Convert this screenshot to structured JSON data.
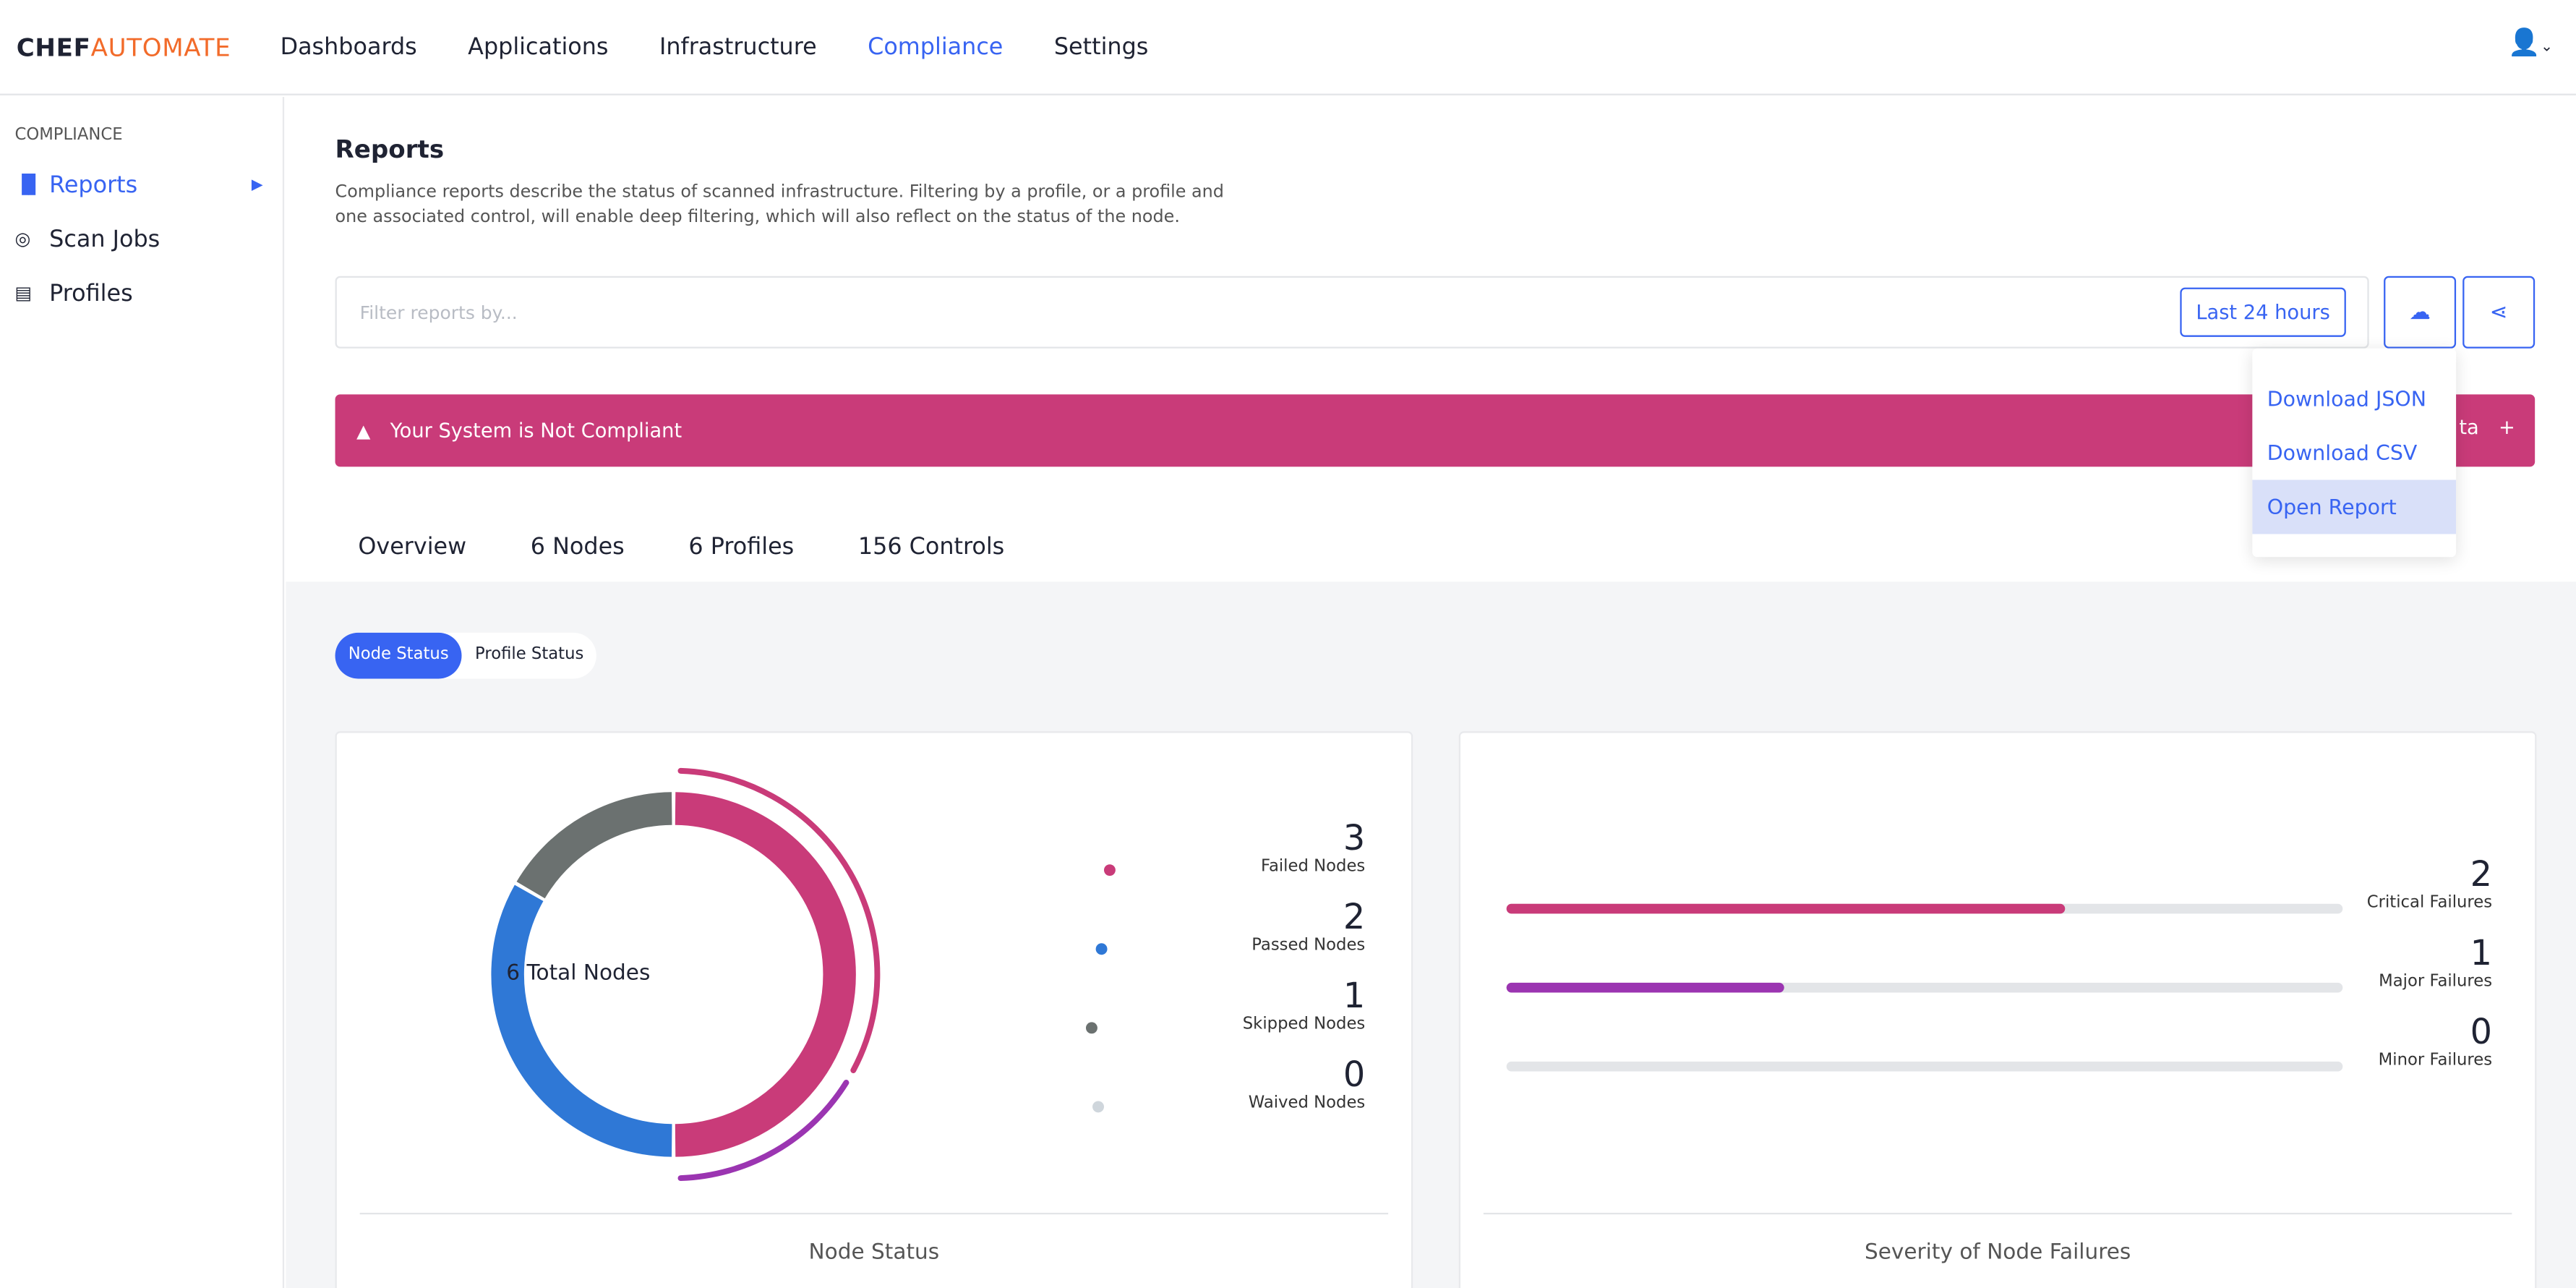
{
  "brand": {
    "part1": "CHEF",
    "part2": "AUTOMATE"
  },
  "nav": [
    "Dashboards",
    "Applications",
    "Infrastructure",
    "Compliance",
    "Settings"
  ],
  "nav_active": "Compliance",
  "sidebar": {
    "heading": "COMPLIANCE",
    "items": [
      {
        "label": "Reports",
        "icon": "bar-chart-icon"
      },
      {
        "label": "Scan Jobs",
        "icon": "radar-icon"
      },
      {
        "label": "Profiles",
        "icon": "book-icon"
      }
    ]
  },
  "page": {
    "title": "Reports",
    "description": "Compliance reports describe the status of scanned infrastructure. Filtering by a profile, or a profile and one associated control, will enable deep filtering, which will also reflect on the status of the node."
  },
  "filter": {
    "placeholder": "Filter reports by...",
    "time_range": "Last 24 hours"
  },
  "download_menu": [
    "Download JSON",
    "Download CSV",
    "Open Report"
  ],
  "alert": {
    "text": "Your System is Not Compliant",
    "partial_right": "ta",
    "plus": "+"
  },
  "tabs": [
    "Overview",
    "6 Nodes",
    "6 Profiles",
    "156 Controls"
  ],
  "toggle": [
    "Node Status",
    "Profile Status"
  ],
  "node_status": {
    "center": "6 Total Nodes",
    "footer": "Node Status",
    "items": [
      {
        "count": "3",
        "label": "Failed Nodes",
        "color": "#c93b79"
      },
      {
        "count": "2",
        "label": "Passed Nodes",
        "color": "#2f78d6"
      },
      {
        "count": "1",
        "label": "Skipped Nodes",
        "color": "#6b7170"
      },
      {
        "count": "0",
        "label": "Waived Nodes",
        "color": "#cfd6dc"
      }
    ]
  },
  "severity": {
    "footer": "Severity of Node Failures",
    "items": [
      {
        "count": "2",
        "label": "Critical Failures",
        "fraction": 0.667,
        "color": "#c93b79"
      },
      {
        "count": "1",
        "label": "Major Failures",
        "fraction": 0.333,
        "color": "#9b35b1"
      },
      {
        "count": "0",
        "label": "Minor Failures",
        "fraction": 0,
        "color": "#e3e5e8"
      }
    ]
  },
  "colors": {
    "accent": "#3864f2",
    "alert": "#c93b79",
    "brand_orange": "#f26b2a"
  }
}
